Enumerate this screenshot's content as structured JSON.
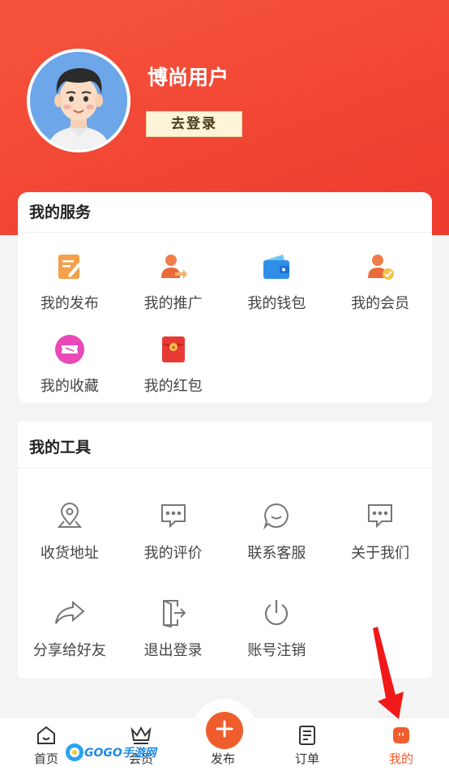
{
  "profile": {
    "username": "博尚用户",
    "login_label": "去登录"
  },
  "services": {
    "title": "我的服务",
    "items": [
      {
        "label": "我的发布",
        "icon": "edit-doc-icon"
      },
      {
        "label": "我的推广",
        "icon": "user-share-icon"
      },
      {
        "label": "我的钱包",
        "icon": "wallet-icon"
      },
      {
        "label": "我的会员",
        "icon": "member-badge-icon"
      },
      {
        "label": "我的收藏",
        "icon": "ticket-icon"
      },
      {
        "label": "我的红包",
        "icon": "red-envelope-icon"
      }
    ]
  },
  "tools": {
    "title": "我的工具",
    "items": [
      {
        "label": "收货地址",
        "icon": "location-icon"
      },
      {
        "label": "我的评价",
        "icon": "comment-icon"
      },
      {
        "label": "联系客服",
        "icon": "chat-icon"
      },
      {
        "label": "关于我们",
        "icon": "info-chat-icon"
      },
      {
        "label": "分享给好友",
        "icon": "share-arrow-icon"
      },
      {
        "label": "退出登录",
        "icon": "logout-door-icon"
      },
      {
        "label": "账号注销",
        "icon": "power-icon"
      }
    ]
  },
  "bottom_nav": {
    "items": [
      {
        "label": "首页",
        "icon": "home-icon"
      },
      {
        "label": "会员",
        "icon": "crown-icon"
      },
      {
        "label": "发布",
        "icon": "plus-icon"
      },
      {
        "label": "订单",
        "icon": "order-doc-icon"
      },
      {
        "label": "我的",
        "icon": "profile-face-icon",
        "active": true
      }
    ],
    "active_color": "#f05d2c"
  },
  "watermark": "GOGO手游网",
  "colors": {
    "header": "#ee3b2e",
    "accent": "#f05d2c",
    "annotation_arrow": "#f01818"
  }
}
